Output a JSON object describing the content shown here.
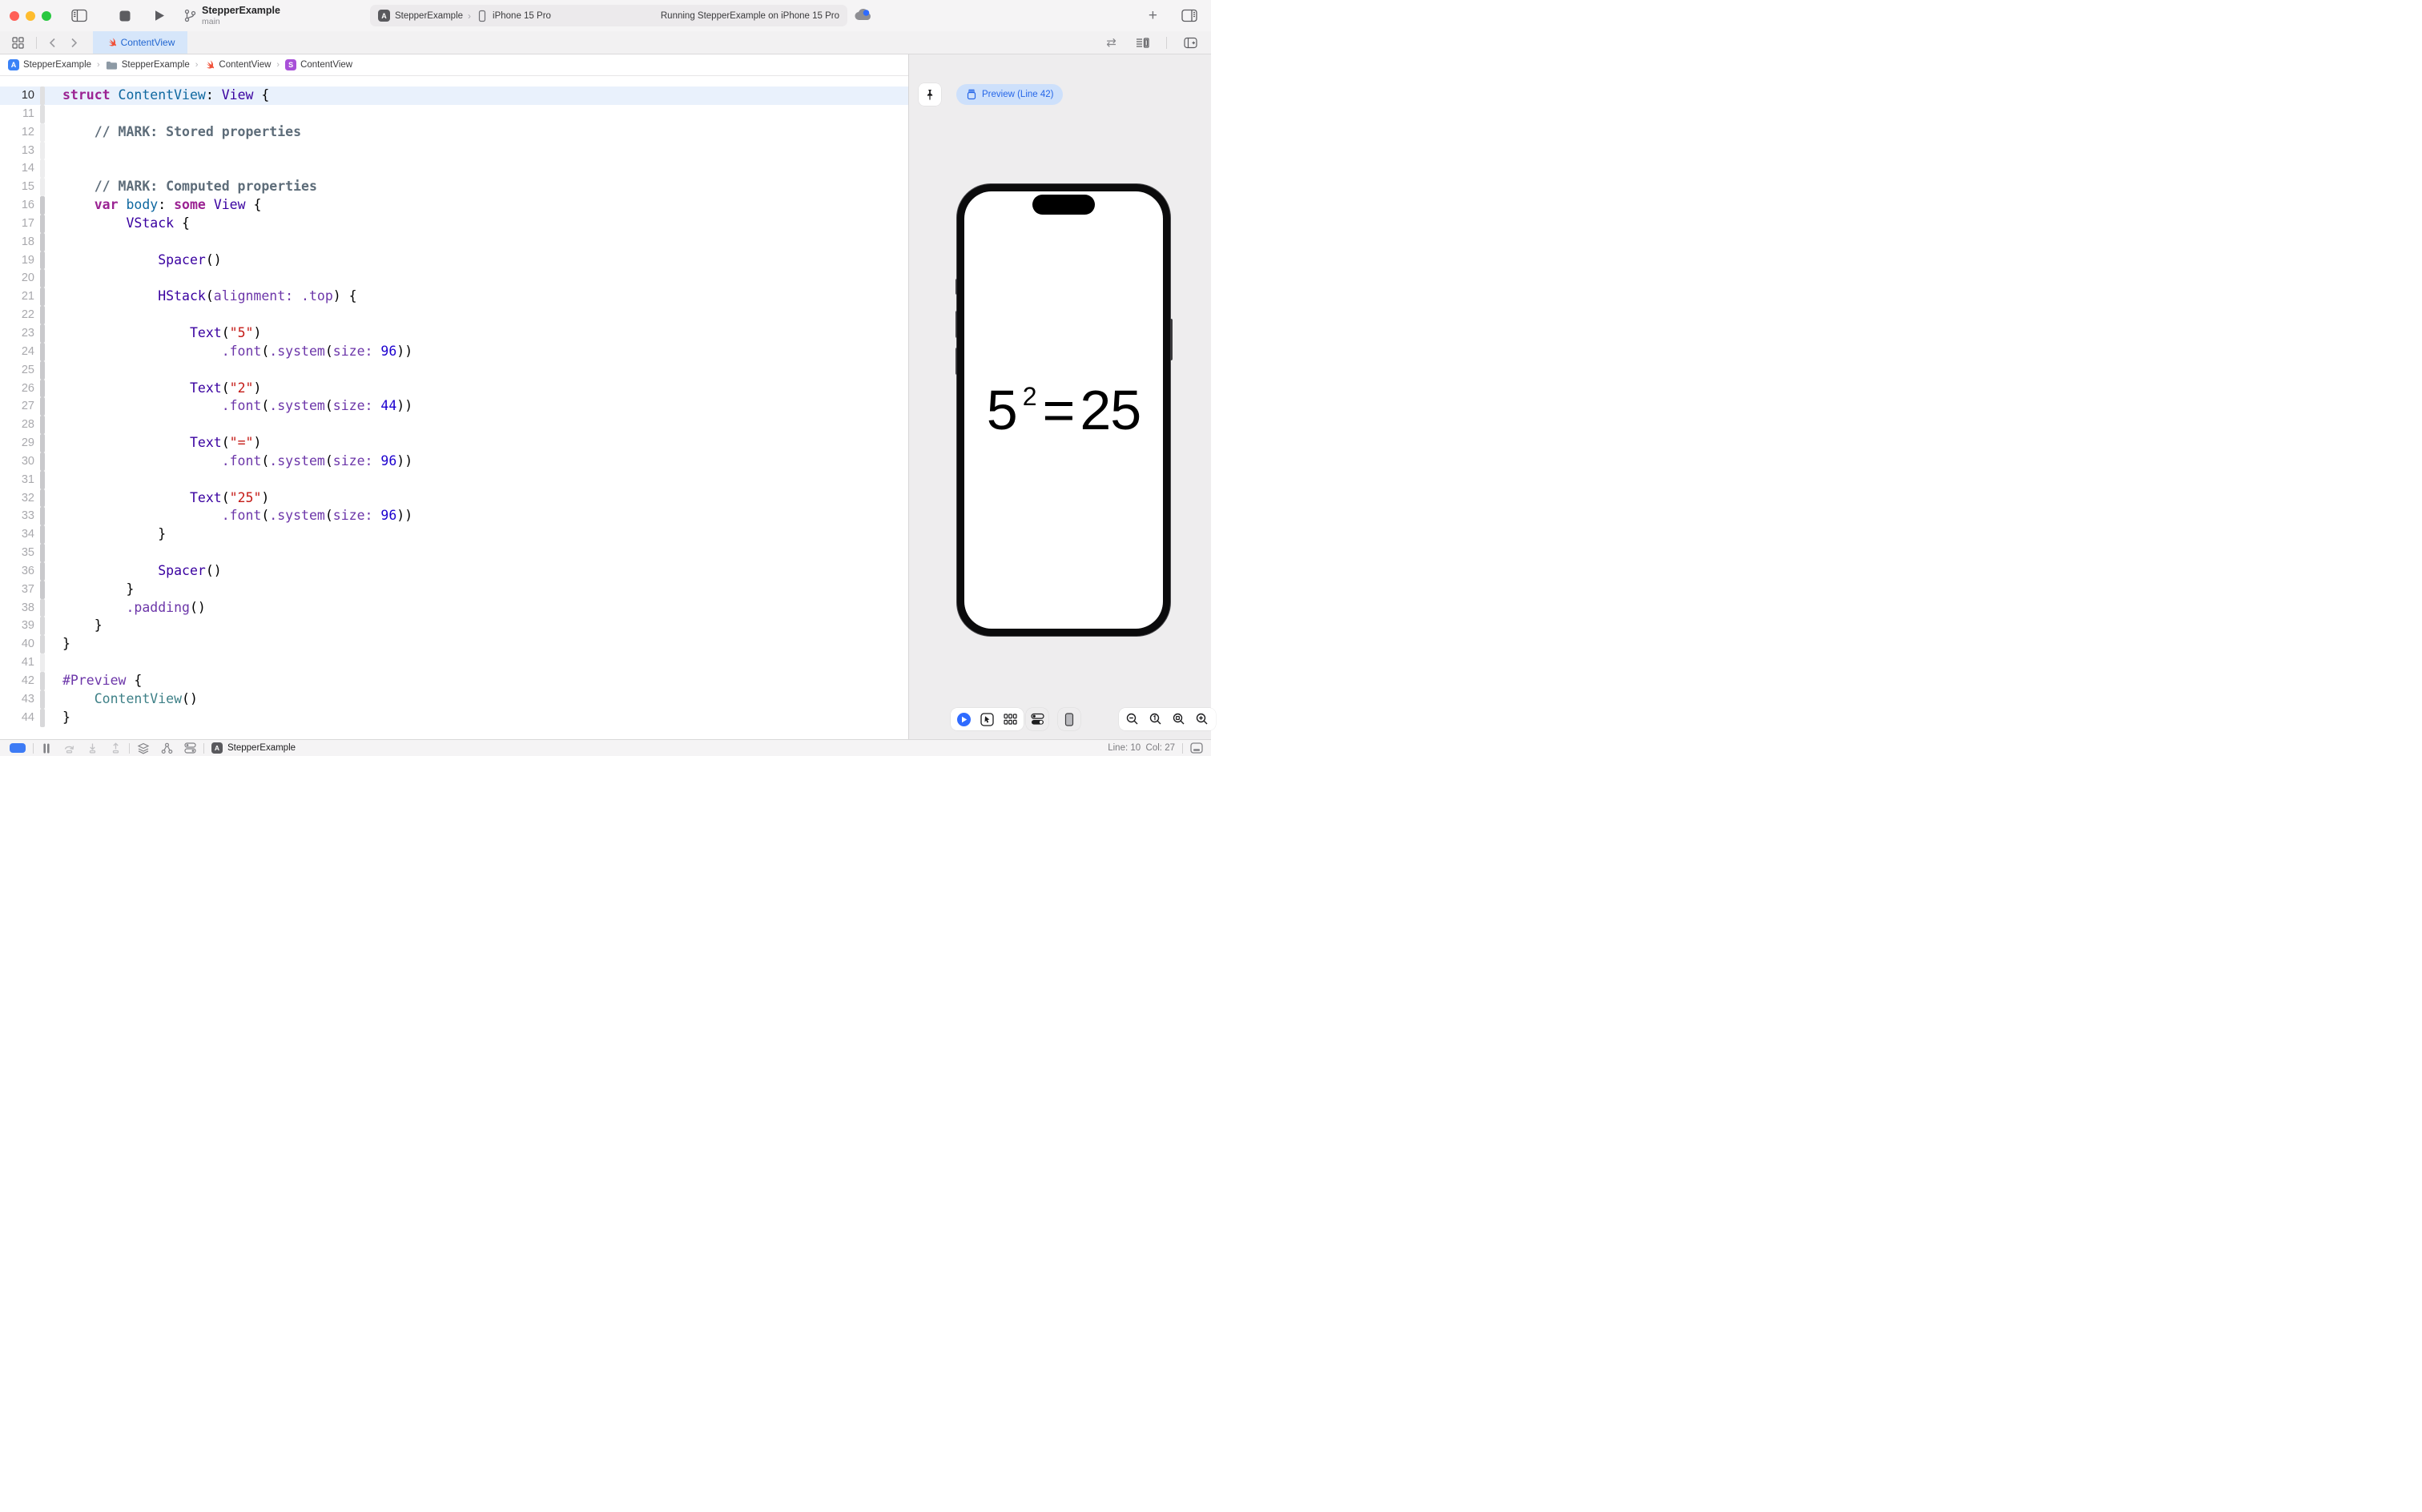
{
  "colors": {
    "accent_blue": "#2166d1",
    "tab_active_bg": "#d6e6fa",
    "preview_pill_bg": "#cde0fb",
    "current_line_bg": "#e9f1fc",
    "canvas_bg": "#eeedee",
    "traffic_red": "#ff5f57",
    "traffic_yellow": "#febc2e",
    "traffic_green": "#28c840",
    "syntax_keyword": "#9b2393",
    "syntax_system_type": "#3900a0",
    "syntax_declaration": "#0f68a0",
    "syntax_project_type": "#3e8087",
    "syntax_member": "#6c36a9",
    "syntax_string": "#c41a16",
    "syntax_number": "#1c00cf",
    "syntax_comment": "#5d6c79"
  },
  "toolbar": {
    "scheme_title": "StepperExample",
    "scheme_branch": "main",
    "status_project": "StepperExample",
    "status_chevron": "›",
    "status_device": "iPhone 15 Pro",
    "status_message": "Running StepperExample on iPhone 15 Pro",
    "app_badge": "A",
    "plus_glyph": "+"
  },
  "tabbar": {
    "active_tab": "ContentView",
    "swap_glyph": "⇄"
  },
  "breadcrumb": {
    "chevron": "›",
    "badge_a": "A",
    "badge_s": "S",
    "items": [
      {
        "label": "StepperExample",
        "icon": "appstore-icon"
      },
      {
        "label": "StepperExample",
        "icon": "folder-icon"
      },
      {
        "label": "ContentView",
        "icon": "swift-icon"
      },
      {
        "label": "ContentView",
        "icon": "s-badge-icon"
      }
    ]
  },
  "editor": {
    "lines": [
      {
        "n": 10,
        "indent": 0,
        "hl": true,
        "chg": "c1",
        "tokens": [
          [
            "kw",
            "struct"
          ],
          [
            "pl",
            " "
          ],
          [
            "de",
            "ContentView"
          ],
          [
            "pl",
            ": "
          ],
          [
            "ty",
            "View"
          ],
          [
            "pl",
            " {"
          ]
        ]
      },
      {
        "n": 11,
        "indent": 0,
        "chg": "c1",
        "tokens": []
      },
      {
        "n": 12,
        "indent": 4,
        "chg": "",
        "tokens": [
          [
            "cm",
            "// MARK: Stored properties"
          ]
        ]
      },
      {
        "n": 13,
        "indent": 0,
        "chg": "",
        "tokens": []
      },
      {
        "n": 14,
        "indent": 0,
        "chg": "",
        "tokens": []
      },
      {
        "n": 15,
        "indent": 4,
        "chg": "",
        "tokens": [
          [
            "cm",
            "// MARK: Computed properties"
          ]
        ]
      },
      {
        "n": 16,
        "indent": 4,
        "chg": "c2",
        "tokens": [
          [
            "kw",
            "var"
          ],
          [
            "pl",
            " "
          ],
          [
            "de",
            "body"
          ],
          [
            "pl",
            ": "
          ],
          [
            "kw",
            "some"
          ],
          [
            "pl",
            " "
          ],
          [
            "ty",
            "View"
          ],
          [
            "pl",
            " {"
          ]
        ]
      },
      {
        "n": 17,
        "indent": 8,
        "chg": "c2",
        "tokens": [
          [
            "ty",
            "VStack"
          ],
          [
            "pl",
            " {"
          ]
        ]
      },
      {
        "n": 18,
        "indent": 0,
        "chg": "c2",
        "tokens": []
      },
      {
        "n": 19,
        "indent": 12,
        "chg": "c2",
        "tokens": [
          [
            "ty",
            "Spacer"
          ],
          [
            "pl",
            "()"
          ]
        ]
      },
      {
        "n": 20,
        "indent": 0,
        "chg": "c2",
        "tokens": []
      },
      {
        "n": 21,
        "indent": 12,
        "chg": "c2",
        "tokens": [
          [
            "ty",
            "HStack"
          ],
          [
            "pl",
            "("
          ],
          [
            "mb",
            "alignment:"
          ],
          [
            "pl",
            " "
          ],
          [
            "mb",
            ".top"
          ],
          [
            "pl",
            ") {"
          ]
        ]
      },
      {
        "n": 22,
        "indent": 0,
        "chg": "c2",
        "tokens": []
      },
      {
        "n": 23,
        "indent": 16,
        "chg": "c2",
        "tokens": [
          [
            "ty",
            "Text"
          ],
          [
            "pl",
            "("
          ],
          [
            "st",
            "\"5\""
          ],
          [
            "pl",
            ")"
          ]
        ]
      },
      {
        "n": 24,
        "indent": 20,
        "chg": "c2",
        "tokens": [
          [
            "mb",
            ".font"
          ],
          [
            "pl",
            "("
          ],
          [
            "mb",
            ".system"
          ],
          [
            "pl",
            "("
          ],
          [
            "mb",
            "size:"
          ],
          [
            "pl",
            " "
          ],
          [
            "nu",
            "96"
          ],
          [
            "pl",
            "))"
          ]
        ]
      },
      {
        "n": 25,
        "indent": 0,
        "chg": "c2",
        "tokens": []
      },
      {
        "n": 26,
        "indent": 16,
        "chg": "c2",
        "tokens": [
          [
            "ty",
            "Text"
          ],
          [
            "pl",
            "("
          ],
          [
            "st",
            "\"2\""
          ],
          [
            "pl",
            ")"
          ]
        ]
      },
      {
        "n": 27,
        "indent": 20,
        "chg": "c2",
        "tokens": [
          [
            "mb",
            ".font"
          ],
          [
            "pl",
            "("
          ],
          [
            "mb",
            ".system"
          ],
          [
            "pl",
            "("
          ],
          [
            "mb",
            "size:"
          ],
          [
            "pl",
            " "
          ],
          [
            "nu",
            "44"
          ],
          [
            "pl",
            "))"
          ]
        ]
      },
      {
        "n": 28,
        "indent": 0,
        "chg": "c2",
        "tokens": []
      },
      {
        "n": 29,
        "indent": 16,
        "chg": "c2",
        "tokens": [
          [
            "ty",
            "Text"
          ],
          [
            "pl",
            "("
          ],
          [
            "st",
            "\"=\""
          ],
          [
            "pl",
            ")"
          ]
        ]
      },
      {
        "n": 30,
        "indent": 20,
        "chg": "c2",
        "tokens": [
          [
            "mb",
            ".font"
          ],
          [
            "pl",
            "("
          ],
          [
            "mb",
            ".system"
          ],
          [
            "pl",
            "("
          ],
          [
            "mb",
            "size:"
          ],
          [
            "pl",
            " "
          ],
          [
            "nu",
            "96"
          ],
          [
            "pl",
            "))"
          ]
        ]
      },
      {
        "n": 31,
        "indent": 0,
        "chg": "c2",
        "tokens": []
      },
      {
        "n": 32,
        "indent": 16,
        "chg": "c2",
        "tokens": [
          [
            "ty",
            "Text"
          ],
          [
            "pl",
            "("
          ],
          [
            "st",
            "\"25\""
          ],
          [
            "pl",
            ")"
          ]
        ]
      },
      {
        "n": 33,
        "indent": 20,
        "chg": "c2",
        "tokens": [
          [
            "mb",
            ".font"
          ],
          [
            "pl",
            "("
          ],
          [
            "mb",
            ".system"
          ],
          [
            "pl",
            "("
          ],
          [
            "mb",
            "size:"
          ],
          [
            "pl",
            " "
          ],
          [
            "nu",
            "96"
          ],
          [
            "pl",
            "))"
          ]
        ]
      },
      {
        "n": 34,
        "indent": 12,
        "chg": "c2",
        "tokens": [
          [
            "pl",
            "}"
          ]
        ]
      },
      {
        "n": 35,
        "indent": 0,
        "chg": "c2",
        "tokens": []
      },
      {
        "n": 36,
        "indent": 12,
        "chg": "c2",
        "tokens": [
          [
            "ty",
            "Spacer"
          ],
          [
            "pl",
            "()"
          ]
        ]
      },
      {
        "n": 37,
        "indent": 8,
        "chg": "c2",
        "tokens": [
          [
            "pl",
            "}"
          ]
        ]
      },
      {
        "n": 38,
        "indent": 8,
        "chg": "c3",
        "tokens": [
          [
            "mb",
            ".padding"
          ],
          [
            "pl",
            "()"
          ]
        ]
      },
      {
        "n": 39,
        "indent": 4,
        "chg": "c3",
        "tokens": [
          [
            "pl",
            "}"
          ]
        ]
      },
      {
        "n": 40,
        "indent": 0,
        "chg": "c3",
        "tokens": [
          [
            "pl",
            "}"
          ]
        ]
      },
      {
        "n": 41,
        "indent": 0,
        "chg": "",
        "tokens": []
      },
      {
        "n": 42,
        "indent": 0,
        "chg": "c3",
        "tokens": [
          [
            "mb",
            "#Preview"
          ],
          [
            "pl",
            " {"
          ]
        ]
      },
      {
        "n": 43,
        "indent": 4,
        "chg": "c3",
        "tokens": [
          [
            "pj",
            "ContentView"
          ],
          [
            "pl",
            "()"
          ]
        ]
      },
      {
        "n": 44,
        "indent": 0,
        "chg": "c3",
        "tokens": [
          [
            "pl",
            "}"
          ]
        ]
      }
    ]
  },
  "canvas": {
    "preview_button": "Preview (Line 42)",
    "equation": {
      "base": "5",
      "exponent": "2",
      "equals": "=",
      "result": "25"
    }
  },
  "statusbar": {
    "app_badge": "A",
    "app_name": "StepperExample",
    "line_col": "Line: 10  Col: 27"
  }
}
